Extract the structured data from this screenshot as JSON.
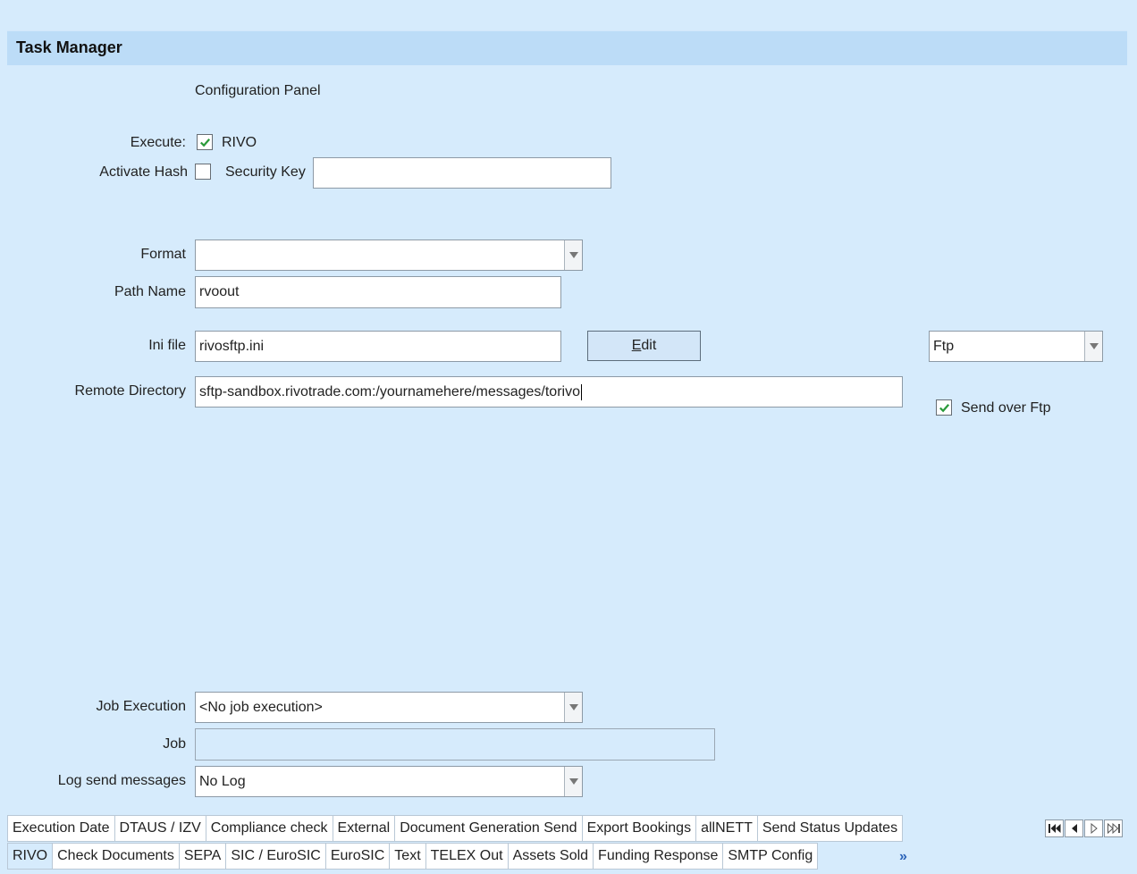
{
  "title": "Task Manager",
  "subtitle": "Configuration Panel",
  "execute": {
    "label": "Execute:",
    "checked": true,
    "text": "RIVO"
  },
  "activate_hash": {
    "label": "Activate Hash",
    "checked": false
  },
  "security_key": {
    "label": "Security Key",
    "value": ""
  },
  "format": {
    "label": "Format",
    "value": ""
  },
  "path_name": {
    "label": "Path Name",
    "value": "rvoout"
  },
  "ini_file": {
    "label": "Ini file",
    "value": "rivosftp.ini"
  },
  "edit_button": {
    "prefix": "E",
    "rest": "dit"
  },
  "protocol_select": {
    "value": "Ftp"
  },
  "remote_directory": {
    "label": "Remote Directory",
    "value": "sftp-sandbox.rivotrade.com:/yournamehere/messages/torivo"
  },
  "send_over_ftp": {
    "label": "Send over Ftp",
    "checked": true
  },
  "job_execution": {
    "label": "Job Execution",
    "value": "<No job execution>"
  },
  "job": {
    "label": "Job",
    "value": ""
  },
  "log_send_messages": {
    "label": "Log send messages",
    "value": "No Log"
  },
  "tabs_row1": [
    "Execution Date",
    "DTAUS / IZV",
    "Compliance check",
    "External",
    "Document Generation Send",
    "Export Bookings",
    "allNETT",
    "Send Status Updates"
  ],
  "tabs_row2": [
    "RIVO",
    "Check Documents",
    "SEPA",
    "SIC / EuroSIC",
    "EuroSIC",
    "Text",
    "TELEX Out",
    "Assets Sold",
    "Funding Response",
    "SMTP Config"
  ],
  "active_tab": "RIVO",
  "more_tabs": "»",
  "icons": [
    "first-page-icon",
    "prev-page-icon",
    "next-page-icon",
    "last-page-icon",
    "checkmark-icon",
    "dropdown-arrow-icon"
  ],
  "colors": {
    "background": "#d6ebfc",
    "titlebar": "#bcdcf7",
    "check": "#2a9a3a"
  }
}
